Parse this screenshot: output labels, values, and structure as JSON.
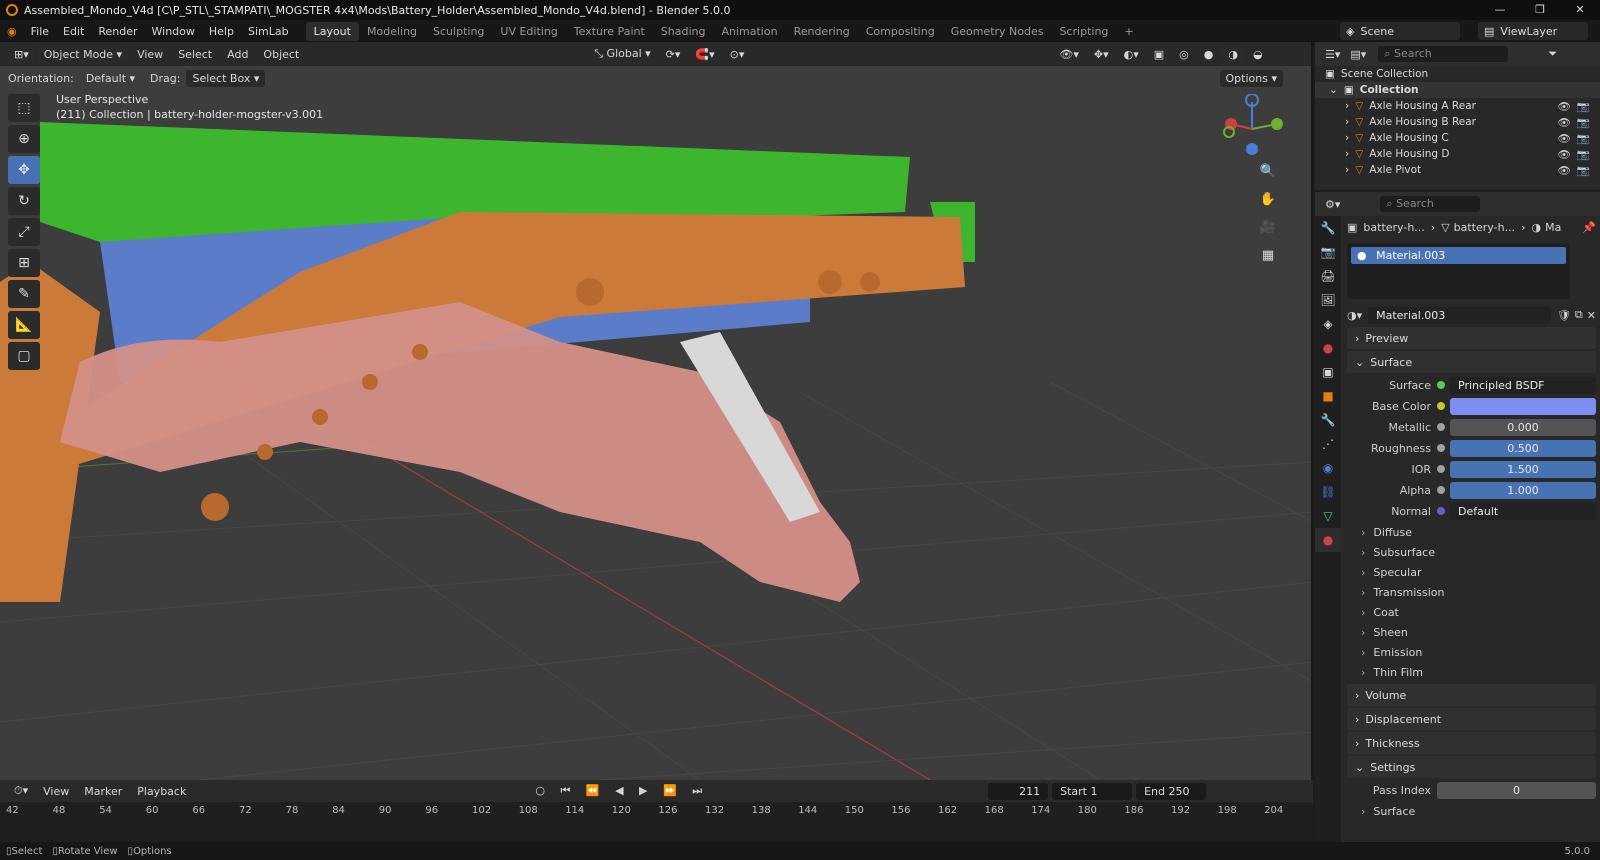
{
  "titlebar": {
    "title": "Assembled_Mondo_V4d [C\\P_STL\\_STAMPATI\\_MOGSTER 4x4\\Mods\\Battery_Holder\\Assembled_Mondo_V4d.blend] - Blender 5.0.0"
  },
  "menu": {
    "items": [
      "File",
      "Edit",
      "Render",
      "Window",
      "Help",
      "SimLab"
    ]
  },
  "workspaces": {
    "tabs": [
      "Layout",
      "Modeling",
      "Sculpting",
      "UV Editing",
      "Texture Paint",
      "Shading",
      "Animation",
      "Rendering",
      "Compositing",
      "Geometry Nodes",
      "Scripting"
    ],
    "active": "Layout"
  },
  "topright": {
    "scene": "Scene",
    "viewlayer": "ViewLayer"
  },
  "viewport": {
    "mode": "Object Mode",
    "menu": [
      "View",
      "Select",
      "Add",
      "Object"
    ],
    "transform": "Global",
    "orientation_label": "Orientation:",
    "orientation_value": "Default",
    "drag_label": "Drag:",
    "drag_value": "Select Box",
    "options": "Options",
    "info_line1": "User Perspective",
    "info_line2": "(211) Collection | battery-holder-mogster-v3.001"
  },
  "timeline": {
    "menu": [
      "View",
      "Marker",
      "Playback"
    ],
    "current_frame": "211",
    "start_label": "Start",
    "start": "1",
    "end_label": "End",
    "end": "250",
    "ruler": [
      "42",
      "48",
      "54",
      "60",
      "66",
      "72",
      "78",
      "84",
      "90",
      "96",
      "102",
      "108",
      "114",
      "120",
      "126",
      "132",
      "138",
      "144",
      "150",
      "156",
      "162",
      "168",
      "174",
      "180",
      "186",
      "192",
      "198",
      "204"
    ]
  },
  "statusbar": {
    "select": "Select",
    "rotate": "Rotate View",
    "options": "Options",
    "version": "5.0.0"
  },
  "outliner": {
    "search_placeholder": "Search",
    "scene_collection": "Scene Collection",
    "collection": "Collection",
    "items": [
      "Axle Housing A Rear",
      "Axle Housing B Rear",
      "Axle Housing C",
      "Axle Housing D",
      "Axle Pivot"
    ]
  },
  "properties": {
    "search_placeholder": "Search",
    "breadcrumb": [
      "battery-h...",
      "battery-h...",
      "Ma"
    ],
    "material_slot": "Material.003",
    "material_name": "Material.003",
    "panels": {
      "preview": "Preview",
      "surface": "Surface"
    },
    "surface_row": {
      "label": "Surface",
      "value": "Principled BSDF"
    },
    "inputs": [
      {
        "label": "Base Color",
        "value": ""
      },
      {
        "label": "Metallic",
        "value": "0.000"
      },
      {
        "label": "Roughness",
        "value": "0.500"
      },
      {
        "label": "IOR",
        "value": "1.500"
      },
      {
        "label": "Alpha",
        "value": "1.000"
      },
      {
        "label": "Normal",
        "value": "Default"
      }
    ],
    "subpanels": [
      "Diffuse",
      "Subsurface",
      "Specular",
      "Transmission",
      "Coat",
      "Sheen",
      "Emission",
      "Thin Film"
    ],
    "sections": [
      "Volume",
      "Displacement",
      "Thickness",
      "Settings"
    ],
    "pass_index_label": "Pass Index",
    "pass_index": "0",
    "last": "Surface"
  },
  "colors": {
    "accent": "#4772b3",
    "base_color": "#7d8df0",
    "frame_green": "#3db52e",
    "frame_orange": "#cc7a3a",
    "axle_pink": "#d49088",
    "battery_blue": "#5b7cc9"
  }
}
